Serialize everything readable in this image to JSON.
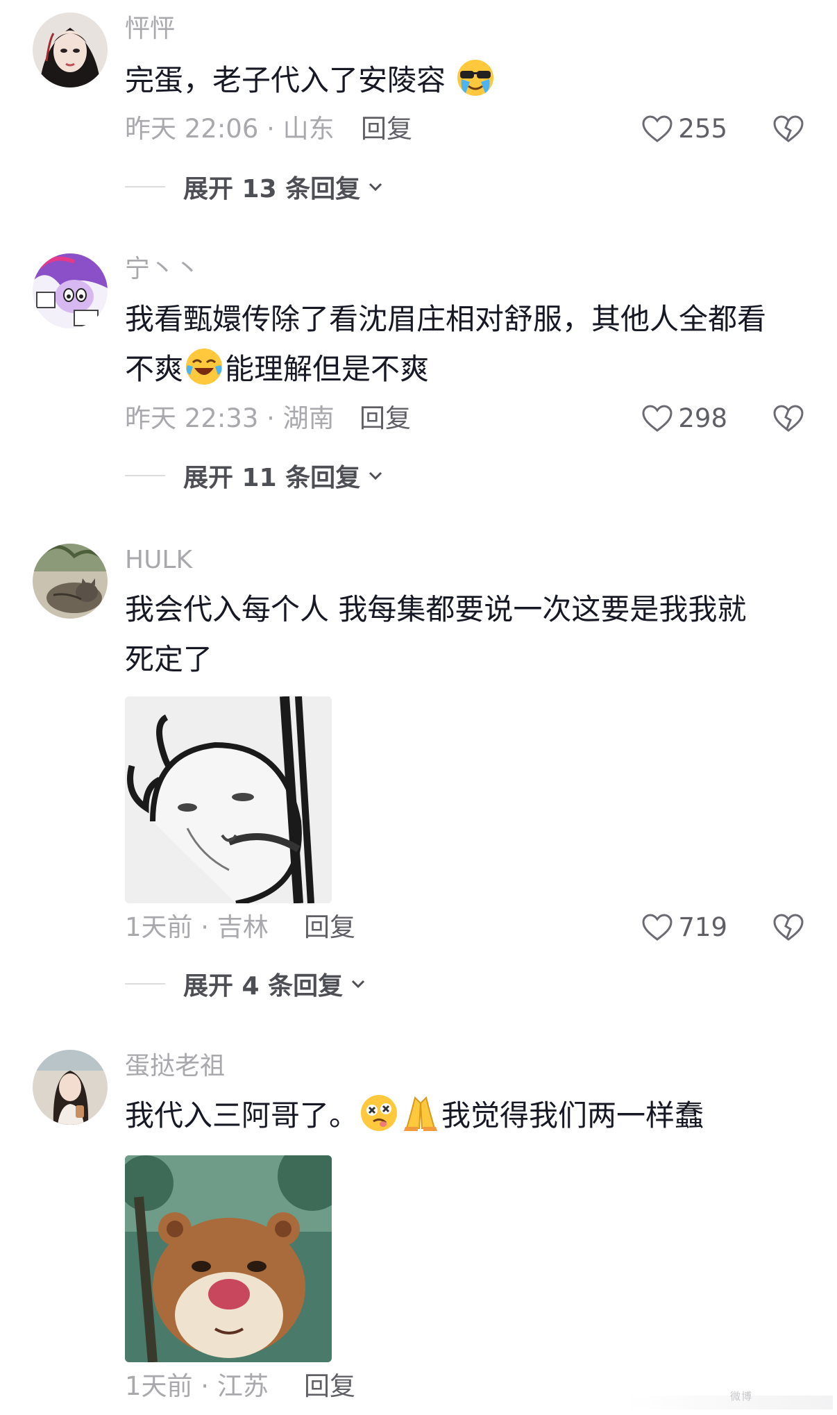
{
  "comments": [
    {
      "username": "怦怦",
      "text_parts": [
        "完蛋，老子代入了安陵容"
      ],
      "time_location": "昨天 22:06 · 山东",
      "reply_label": "回复",
      "likes": "255",
      "expand_label": "展开 13 条回复"
    },
    {
      "username": "宁丶丶",
      "text_line1": "我看甄嬛传除了看沈眉庄相对舒服，其他人全都看",
      "text_line2_a": "不爽",
      "text_line2_b": "能理解但是不爽",
      "time_location": "昨天 22:33 · 湖南",
      "reply_label": "回复",
      "likes": "298",
      "expand_label": "展开 11 条回复"
    },
    {
      "username": "HULK",
      "text_line1": "我会代入每个人 我每集都要说一次这要是我我就",
      "text_line2": "死定了",
      "time_location": "1天前 · 吉林",
      "reply_label": "回复",
      "likes": "719",
      "expand_label": "展开 4 条回复"
    },
    {
      "username": "蛋挞老祖",
      "text_a": "我代入三阿哥了。",
      "text_b": "我觉得我们两一样蠢",
      "time_location": "1天前 · 江苏",
      "reply_label": "回复"
    }
  ],
  "watermark": "微博",
  "colors": {
    "meta_gray": "#a8a8ad",
    "text_dark": "#161823",
    "action_gray": "#5f5f66"
  },
  "icons": {
    "like": "heart-outline-icon",
    "dislike": "broken-heart-icon",
    "expand": "chevron-down-icon"
  }
}
